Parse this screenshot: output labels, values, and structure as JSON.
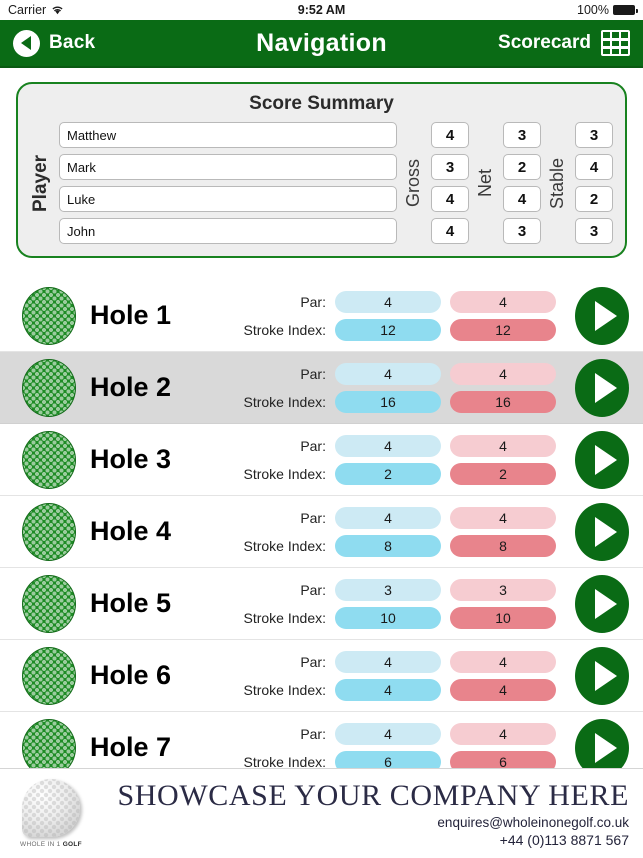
{
  "status_bar": {
    "carrier": "Carrier",
    "wifi_icon": "wifi-icon",
    "time": "9:52 AM",
    "battery_percent": "100%"
  },
  "navbar": {
    "back_label": "Back",
    "back_icon": "back-circle-arrow-icon",
    "title": "Navigation",
    "scorecard_label": "Scorecard",
    "scorecard_icon": "grid-icon",
    "background_color": "#0a6b15"
  },
  "score_summary": {
    "title": "Score Summary",
    "player_label": "Player",
    "gross_label": "Gross",
    "net_label": "Net",
    "stable_label": "Stable",
    "rows": [
      {
        "player": "Matthew",
        "gross": "4",
        "net": "3",
        "stable": "3"
      },
      {
        "player": "Mark",
        "gross": "3",
        "net": "2",
        "stable": "4"
      },
      {
        "player": "Luke",
        "gross": "4",
        "net": "4",
        "stable": "2"
      },
      {
        "player": "John",
        "gross": "4",
        "net": "3",
        "stable": "3"
      }
    ]
  },
  "holes": {
    "par_label": "Par:",
    "stroke_index_label": "Stroke Index:",
    "ball_icon": "golf-ball-icon",
    "play_icon": "play-arrow-icon",
    "items": [
      {
        "name": "Hole 1",
        "par": "4",
        "stroke_index": "12",
        "par_alt": "4",
        "stroke_index_alt": "12",
        "highlighted": false
      },
      {
        "name": "Hole 2",
        "par": "4",
        "stroke_index": "16",
        "par_alt": "4",
        "stroke_index_alt": "16",
        "highlighted": true
      },
      {
        "name": "Hole 3",
        "par": "4",
        "stroke_index": "2",
        "par_alt": "4",
        "stroke_index_alt": "2",
        "highlighted": false
      },
      {
        "name": "Hole 4",
        "par": "4",
        "stroke_index": "8",
        "par_alt": "4",
        "stroke_index_alt": "8",
        "highlighted": false
      },
      {
        "name": "Hole 5",
        "par": "3",
        "stroke_index": "10",
        "par_alt": "3",
        "stroke_index_alt": "10",
        "highlighted": false
      },
      {
        "name": "Hole 6",
        "par": "4",
        "stroke_index": "4",
        "par_alt": "4",
        "stroke_index_alt": "4",
        "highlighted": false
      },
      {
        "name": "Hole 7",
        "par": "4",
        "stroke_index": "6",
        "par_alt": "4",
        "stroke_index_alt": "6",
        "highlighted": false
      }
    ]
  },
  "footer_ad": {
    "headline": "SHOWCASE YOUR COMPANY HERE",
    "email": "enquires@wholeinonegolf.co.uk",
    "phone": "+44 (0)113 8871 567",
    "logo_icon": "golf-ball-logo-icon",
    "logo_text_prefix": "WHOLE IN 1 ",
    "logo_text_brand": "GOLF"
  },
  "colors": {
    "brand_green": "#0a6b15",
    "summary_border": "#18821f",
    "par_blue": "#cdeaf4",
    "stroke_blue": "#8fdcf0",
    "par_red": "#f6ccd1",
    "stroke_red": "#e8848c",
    "row_highlight": "#d9d9d9"
  }
}
